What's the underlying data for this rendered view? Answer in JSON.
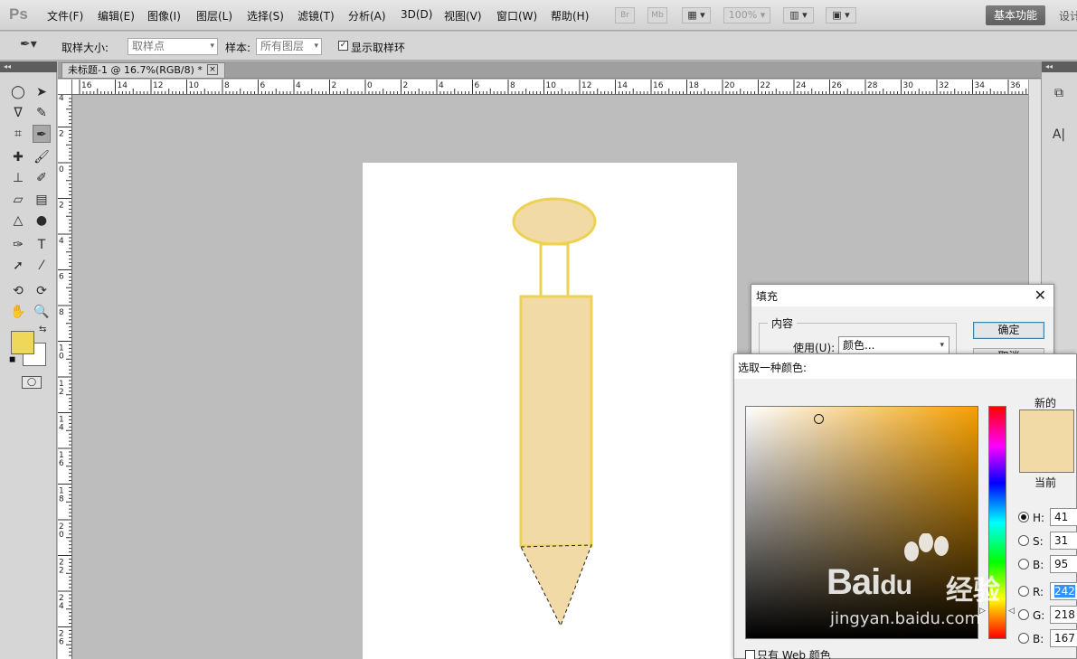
{
  "app": {
    "logo": "Ps",
    "menus": [
      "文件(F)",
      "编辑(E)",
      "图像(I)",
      "图层(L)",
      "选择(S)",
      "滤镜(T)",
      "分析(A)",
      "3D(D)",
      "视图(V)",
      "窗口(W)",
      "帮助(H)"
    ],
    "br_label": "Br",
    "mb_label": "Mb",
    "zoom": "100%",
    "workspace": "基本功能",
    "design": "设计"
  },
  "options": {
    "sample_size_label": "取样大小:",
    "sample_size_value": "取样点",
    "sample_label": "样本:",
    "sample_value": "所有图层",
    "show_ring_label": "显示取样环",
    "show_ring_checked": true
  },
  "document": {
    "tab_title": "未标题-1 @ 16.7%(RGB/8) *",
    "close": "×"
  },
  "rulers": {
    "h_labels": [
      "16",
      "14",
      "12",
      "10",
      "8",
      "6",
      "4",
      "2",
      "0",
      "2",
      "4",
      "6",
      "8",
      "10",
      "12",
      "14",
      "16",
      "18",
      "20",
      "22",
      "24",
      "26",
      "28",
      "30",
      "32",
      "34",
      "36"
    ],
    "v_labels": [
      "4",
      "2",
      "0",
      "2",
      "4",
      "6",
      "8",
      "10",
      "12",
      "14",
      "16",
      "18",
      "20",
      "22",
      "24",
      "26"
    ]
  },
  "toolbox": {
    "foreground_color": "#efd75a",
    "background_color": "#ffffff"
  },
  "drawing": {
    "fill_color": "#f2daa7",
    "stroke_color": "#ecd24f"
  },
  "fill_dialog": {
    "title": "填充",
    "group_label": "内容",
    "use_label": "使用(U):",
    "use_value": "颜色...",
    "ok": "确定",
    "cancel": "取消",
    "close": "✕"
  },
  "color_picker": {
    "title": "选取一种颜色:",
    "new_label": "新的",
    "current_label": "当前",
    "new_color": "#f2daa7",
    "hue_color": "#f5a000",
    "fields": {
      "H": "41",
      "S": "31",
      "B_hsb": "95",
      "R": "242",
      "G": "218",
      "B_rgb": "167"
    },
    "field_labels": {
      "H": "H:",
      "S": "S:",
      "B_hsb": "B:",
      "R": "R:",
      "G": "G:",
      "B_rgb": "B:"
    },
    "web_only_label": "只有 Web 颜色"
  },
  "watermark": {
    "brand": "Bai",
    "brand_du": "du",
    "brand_cn": "经验",
    "url": "jingyan.baidu.com"
  }
}
